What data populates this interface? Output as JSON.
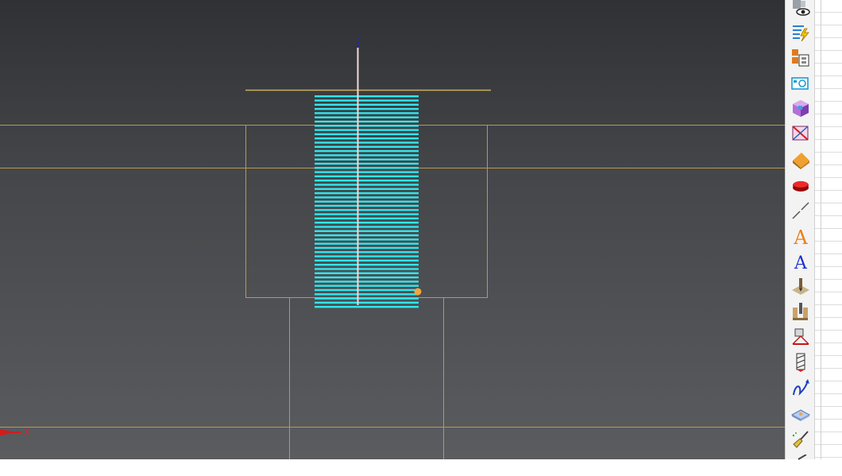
{
  "viewport": {
    "background_top": "#2f3134",
    "background_bottom": "#5a5c5f",
    "outline_color": "#b59a55",
    "toolpath_color": "#2fe8f0",
    "tool_axis_color": "#f4d9d9",
    "axis_label_x": "X"
  },
  "toolbar": {
    "items": [
      {
        "name": "view-visibility-icon"
      },
      {
        "name": "generate-toolpath-icon"
      },
      {
        "name": "copy-operations-icon"
      },
      {
        "name": "simulation-icon"
      },
      {
        "name": "stock-model-icon"
      },
      {
        "name": "verify-toolpath-icon"
      },
      {
        "name": "3d-shape-icon"
      },
      {
        "name": "solid-object-icon"
      },
      {
        "name": "line-tool-icon"
      },
      {
        "name": "text-orange-icon"
      },
      {
        "name": "text-blue-icon"
      },
      {
        "name": "drill-down-icon"
      },
      {
        "name": "machining-setup-icon"
      },
      {
        "name": "fixture-icon"
      },
      {
        "name": "end-mill-icon"
      },
      {
        "name": "toolpath-arrow-icon"
      },
      {
        "name": "surface-plane-icon"
      },
      {
        "name": "broom-cleanup-icon"
      }
    ]
  }
}
